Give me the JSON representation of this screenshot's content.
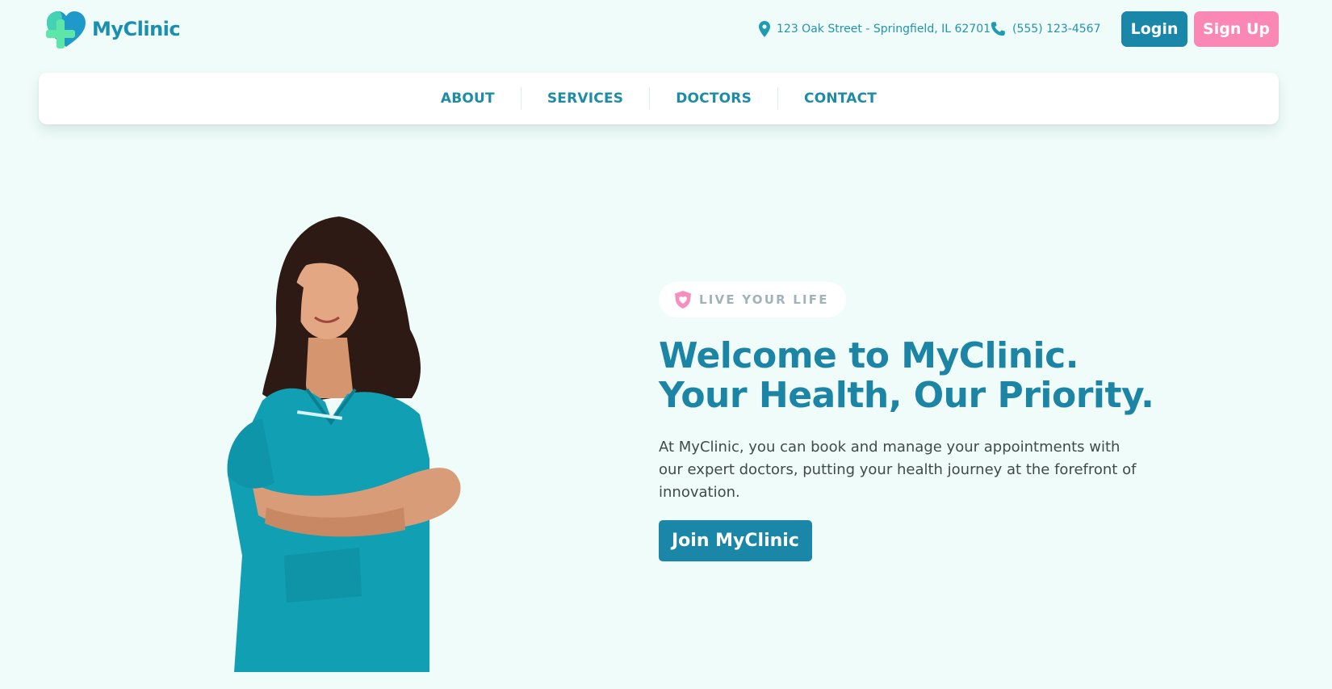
{
  "brand": {
    "name": "MyClinic",
    "primary_color": "#1a86a8",
    "accent_color": "#fb88b4",
    "background_color": "#effcf9",
    "logo_icon": "heart-cross-icon"
  },
  "header": {
    "address": "123 Oak Street - Springfield, IL 62701",
    "address_icon": "map-pin-icon",
    "phone": "(555) 123-4567",
    "phone_icon": "phone-icon",
    "login_label": "Login",
    "signup_label": "Sign Up"
  },
  "nav": {
    "items": [
      {
        "label": "ABOUT"
      },
      {
        "label": "SERVICES"
      },
      {
        "label": "DOCTORS"
      },
      {
        "label": "CONTACT"
      }
    ]
  },
  "hero": {
    "tagline": "LIVE YOUR LIFE",
    "tagline_icon": "shield-heart-icon",
    "title": "Welcome to MyClinic. Your Health, Our Priority.",
    "description": "At MyClinic, you can book and manage your appointments with our expert doctors, putting your health journey at the forefront of innovation.",
    "cta_label": "Join MyClinic",
    "image": "doctor-photo"
  }
}
